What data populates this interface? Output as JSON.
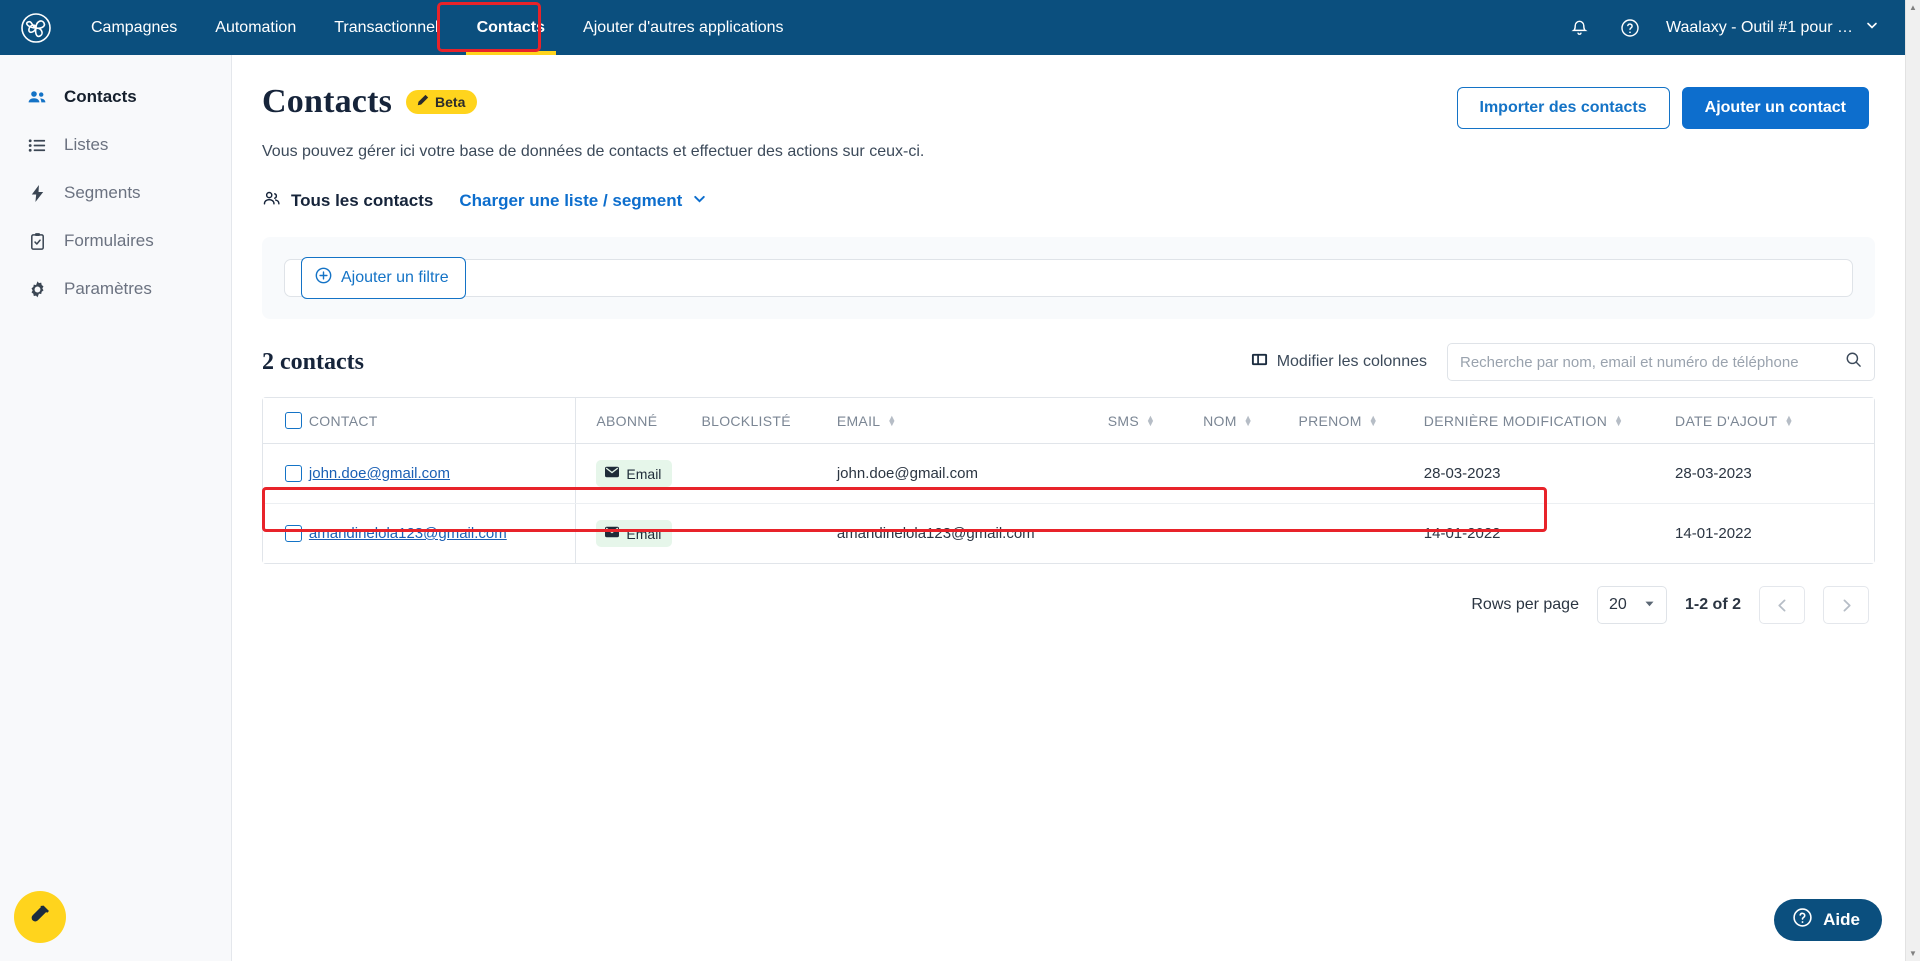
{
  "topnav": {
    "logo_icon": "brand-swirl-icon",
    "items": [
      {
        "label": "Campagnes",
        "active": false
      },
      {
        "label": "Automation",
        "active": false
      },
      {
        "label": "Transactionnel",
        "active": false
      },
      {
        "label": "Contacts",
        "active": true
      },
      {
        "label": "Ajouter d'autres applications",
        "active": false
      }
    ],
    "bell_icon": "bell-icon",
    "help_icon": "help-circle-icon",
    "account_label": "Waalaxy - Outil #1 pour …",
    "account_caret": "chevron-down-icon"
  },
  "sidebar": {
    "items": [
      {
        "label": "Contacts",
        "icon": "users-icon",
        "active": true
      },
      {
        "label": "Listes",
        "icon": "list-icon",
        "active": false
      },
      {
        "label": "Segments",
        "icon": "bolt-icon",
        "active": false
      },
      {
        "label": "Formulaires",
        "icon": "clipboard-check-icon",
        "active": false
      },
      {
        "label": "Paramètres",
        "icon": "gear-icon",
        "active": false
      }
    ]
  },
  "header": {
    "title": "Contacts",
    "beta_badge": "Beta",
    "beta_icon": "pencil-icon",
    "subtitle": "Vous pouvez gérer ici votre base de données de contacts et effectuer des actions sur ceux-ci.",
    "import_button": "Importer des contacts",
    "add_button": "Ajouter un contact"
  },
  "tabs": {
    "all_contacts": "Tous les contacts",
    "all_contacts_icon": "users-icon",
    "load_list": "Charger une liste / segment",
    "load_list_caret": "chevron-down-icon"
  },
  "filters": {
    "add_filter_button": "Ajouter un filtre",
    "add_filter_icon": "plus-circle-icon"
  },
  "toolbar": {
    "count_title": "2  contacts",
    "edit_columns": "Modifier les colonnes",
    "edit_columns_icon": "columns-icon",
    "search_placeholder": "Recherche par nom, email et numéro de téléphone",
    "search_value": "",
    "search_icon": "search-icon"
  },
  "table": {
    "columns": [
      {
        "label": "CONTACT",
        "sortable": false
      },
      {
        "label": "ABONNÉ",
        "sortable": false
      },
      {
        "label": "BLOCKLISTÉ",
        "sortable": false
      },
      {
        "label": "EMAIL",
        "sortable": true
      },
      {
        "label": "SMS",
        "sortable": true
      },
      {
        "label": "NOM",
        "sortable": true
      },
      {
        "label": "PRENOM",
        "sortable": true
      },
      {
        "label": "DERNIÈRE MODIFICATION",
        "sortable": true
      },
      {
        "label": "DATE D'AJOUT",
        "sortable": true
      }
    ],
    "rows": [
      {
        "contact": "john.doe@gmail.com",
        "abonne": "Email",
        "abonne_icon": "envelope-icon",
        "blockliste": "",
        "email": "john.doe@gmail.com",
        "sms": "",
        "nom": "",
        "prenom": "",
        "derniere_modification": "28-03-2023",
        "date_ajout": "28-03-2023",
        "highlighted": true
      },
      {
        "contact": "amandinelola123@gmail.com",
        "abonne": "Email",
        "abonne_icon": "envelope-icon",
        "blockliste": "",
        "email": "amandinelola123@gmail.com",
        "sms": "",
        "nom": "",
        "prenom": "",
        "derniere_modification": "14-01-2022",
        "date_ajout": "14-01-2022",
        "highlighted": false
      }
    ]
  },
  "pagination": {
    "rows_per_page_label": "Rows per page",
    "rows_per_page_value": "20",
    "range": "1-2 of 2",
    "prev_icon": "chevron-left-icon",
    "next_icon": "chevron-right-icon"
  },
  "floating": {
    "fab_icon": "test-tube-icon",
    "help_label": "Aide",
    "help_icon": "question-circle-icon"
  },
  "colors": {
    "nav_bg": "#0b4f7e",
    "accent_blue": "#0d6ecd",
    "link_blue": "#1473c6",
    "badge_yellow": "#ffd41d",
    "chip_green": "#e6f6ea",
    "annotation_red": "#e8232a"
  }
}
